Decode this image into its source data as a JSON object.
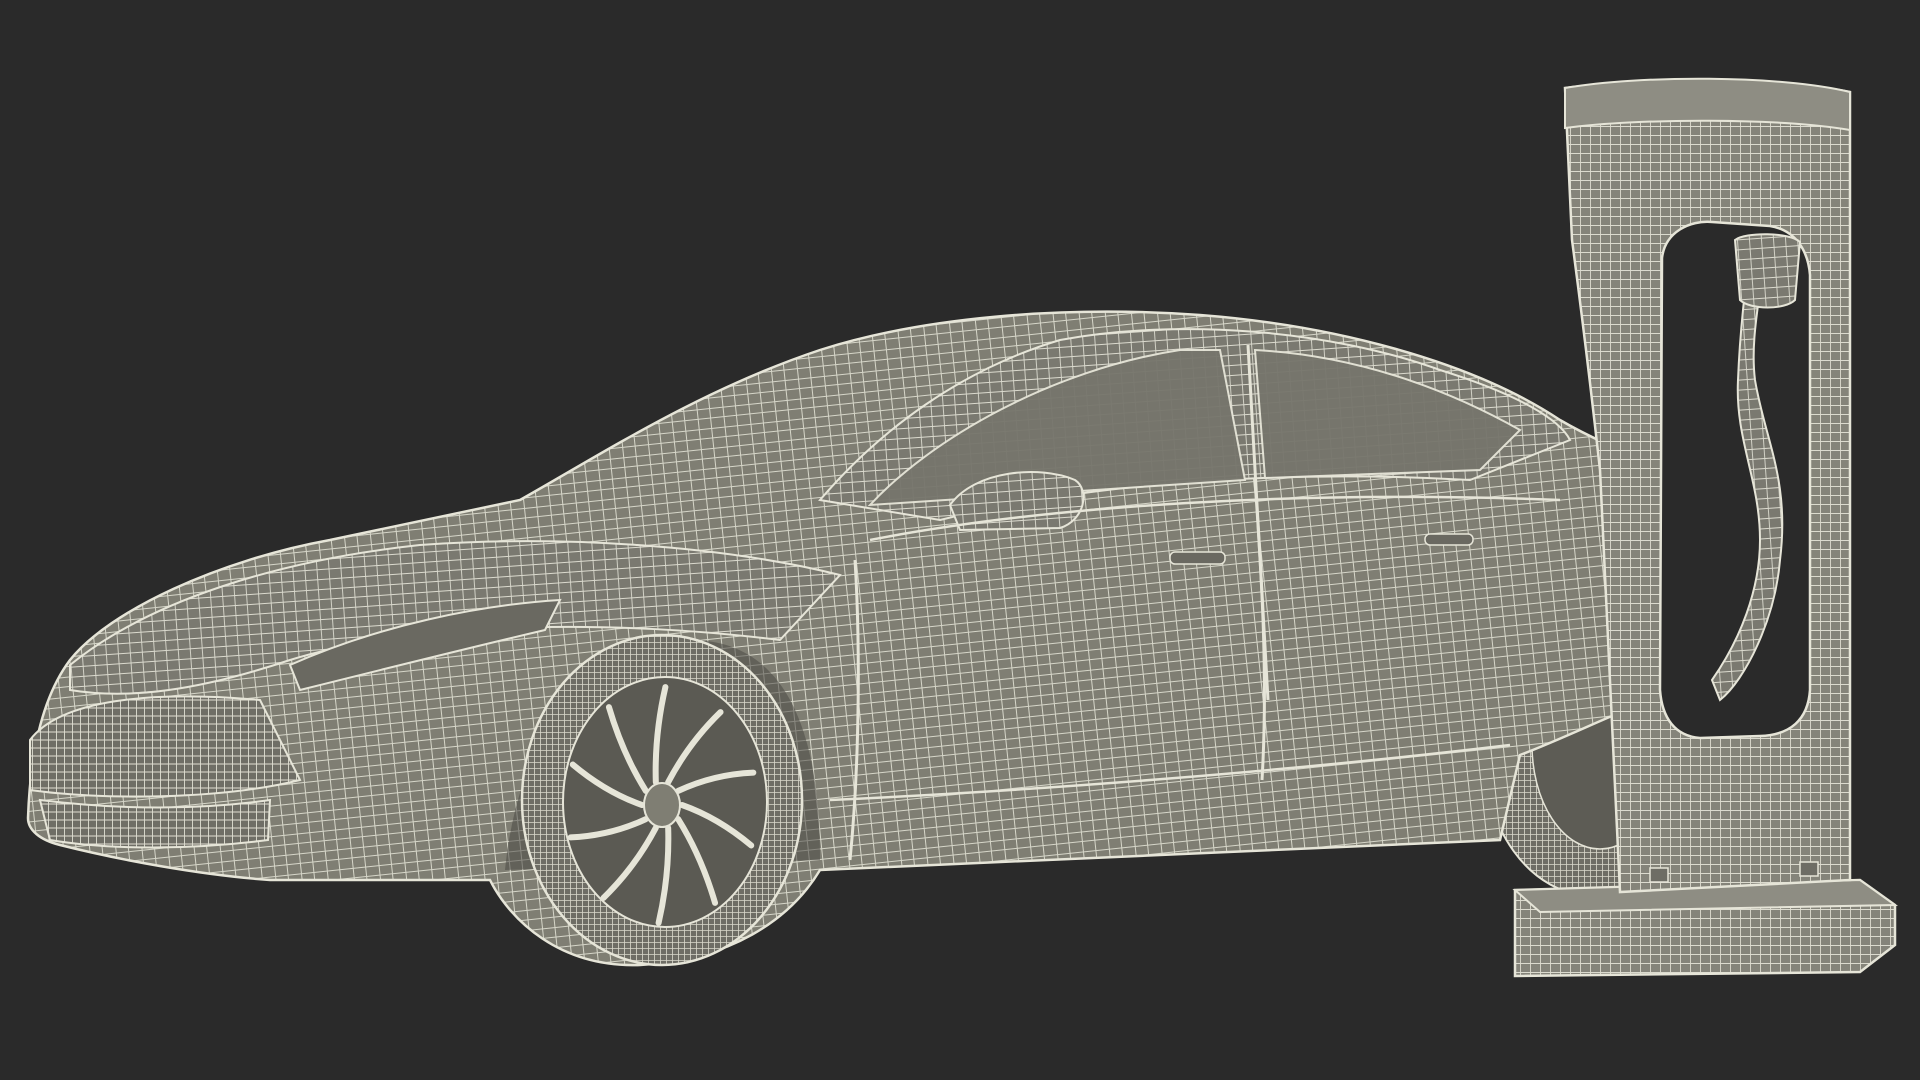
{
  "scene": {
    "background_color": "#2a2a2a",
    "mesh_fill_color": "#7f7e73",
    "mesh_wire_color": "#e6e5d8",
    "mesh_shadow_color": "#6c6b62",
    "objects": [
      "electric-sedan-wireframe",
      "charging-station-wireframe"
    ]
  }
}
